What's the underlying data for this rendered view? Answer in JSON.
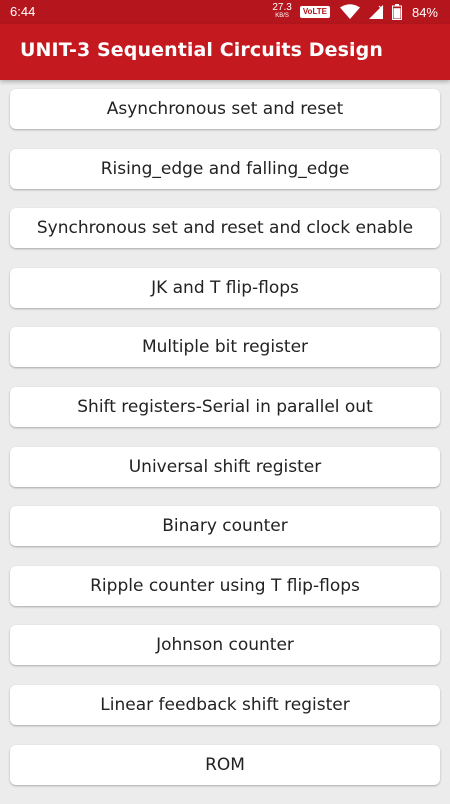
{
  "status_bar": {
    "time": "6:44",
    "net_speed_value": "27.3",
    "net_speed_unit": "KB/S",
    "volte_label": "VoLTE",
    "battery": "84%",
    "icons": [
      "wifi-icon",
      "signal-icon",
      "battery-icon"
    ]
  },
  "app_bar": {
    "title": "UNIT-3 Sequential Circuits Design",
    "color": "#c3191f"
  },
  "topics": [
    "Asynchronous set and reset",
    "Rising_edge and falling_edge",
    "Synchronous set and reset and clock enable",
    "JK and T flip-flops",
    "Multiple bit register",
    "Shift registers-Serial in parallel out",
    "Universal shift register",
    "Binary counter",
    "Ripple counter using T flip-flops",
    "Johnson counter",
    "Linear feedback shift register",
    "ROM"
  ]
}
